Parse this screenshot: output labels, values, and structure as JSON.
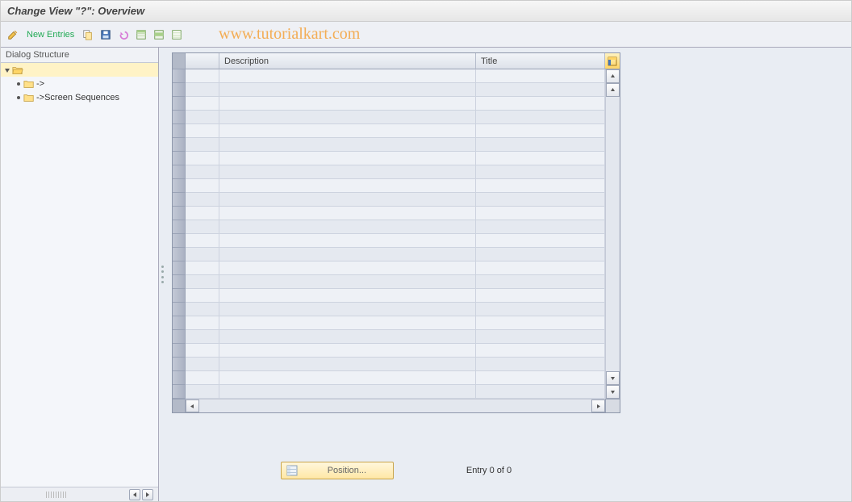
{
  "title": "Change View \"?\": Overview",
  "toolbar": {
    "new_entries_label": "New Entries"
  },
  "watermark": "www.tutorialkart.com",
  "sidebar": {
    "header": "Dialog Structure",
    "items": [
      {
        "label": "",
        "selected": true,
        "depth": 0,
        "expanded": true
      },
      {
        "label": "->",
        "selected": false,
        "depth": 1,
        "expanded": false
      },
      {
        "label": "->Screen Sequences",
        "selected": false,
        "depth": 1,
        "expanded": false
      }
    ]
  },
  "grid": {
    "columns": {
      "col1": "",
      "description": "Description",
      "title": "Title"
    },
    "row_count": 24
  },
  "footer": {
    "position_label": "Position...",
    "entry_status": "Entry 0 of 0"
  },
  "icon_names": {
    "edit": "edit-pencil-icon",
    "copy": "copy-icon",
    "save": "save-icon",
    "undo": "undo-icon",
    "select_all": "select-all-icon",
    "select_block": "select-block-icon",
    "deselect": "deselect-icon",
    "config": "table-settings-icon",
    "folder_open": "folder-open-icon",
    "folder_closed": "folder-closed-icon",
    "position": "position-icon"
  }
}
